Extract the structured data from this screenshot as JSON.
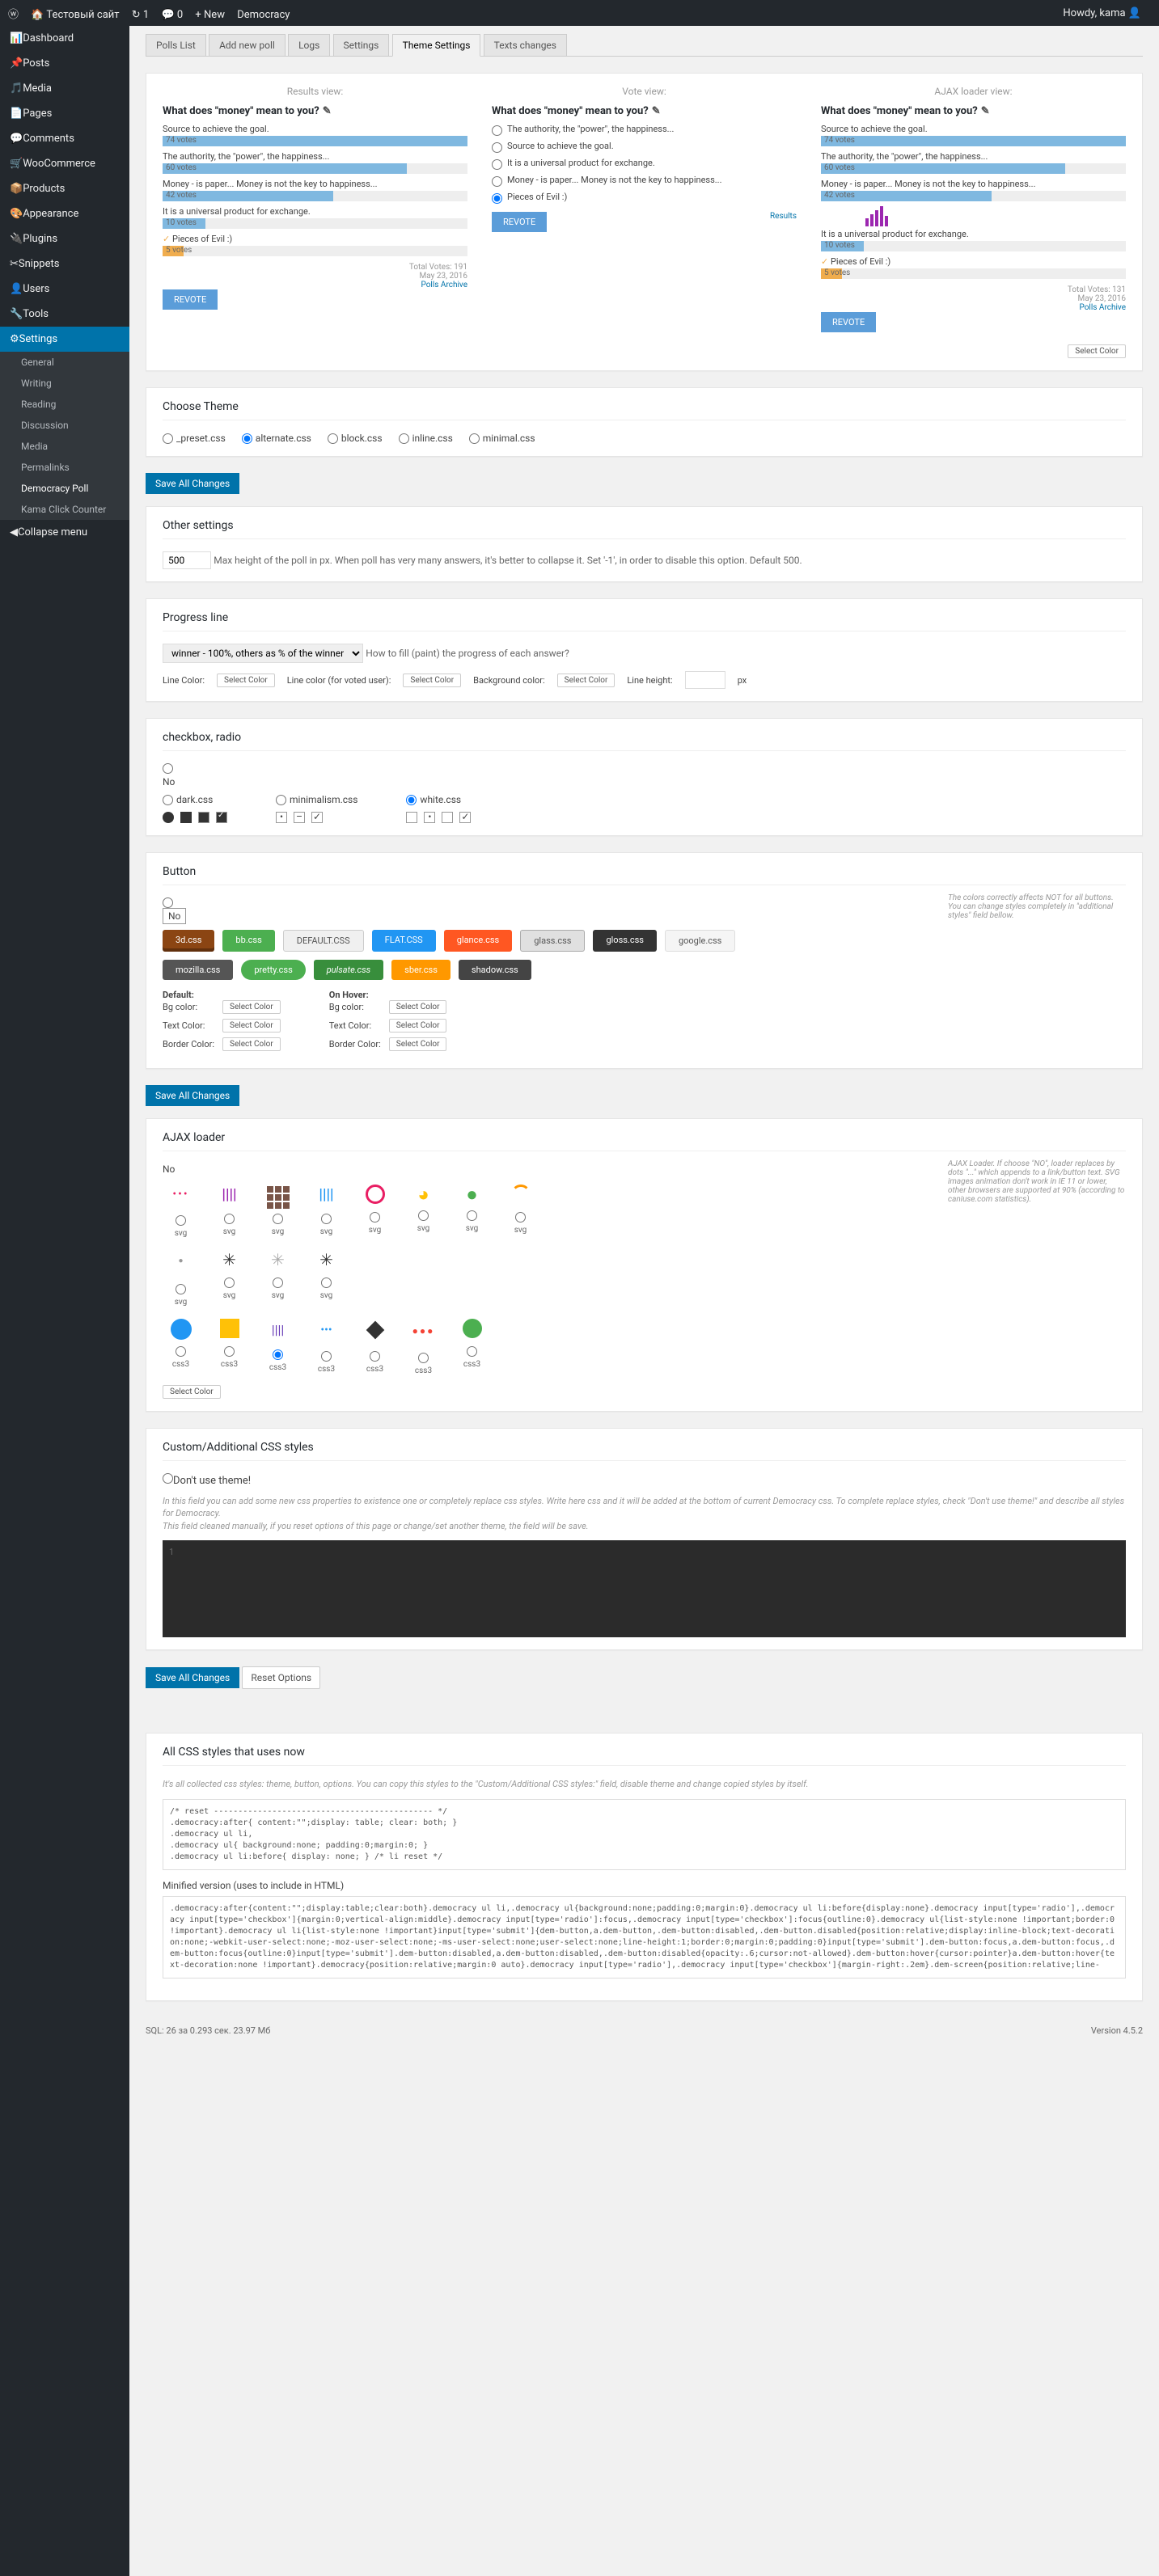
{
  "adminbar": {
    "site": "Тестовый сайт",
    "updates": "1",
    "comments": "0",
    "new": "+ New",
    "current_page": "Democracy",
    "howdy": "Howdy, kama"
  },
  "menu": {
    "items": [
      "Dashboard",
      "Posts",
      "Media",
      "Pages",
      "Comments",
      "WooCommerce",
      "Products",
      "Appearance",
      "Plugins",
      "Snippets",
      "Users",
      "Tools",
      "Settings"
    ],
    "sub": [
      "General",
      "Writing",
      "Reading",
      "Discussion",
      "Media",
      "Permalinks",
      "Democracy Poll",
      "Kama Click Counter"
    ],
    "collapse": "Collapse menu"
  },
  "tabs": [
    "Polls List",
    "Add new poll",
    "Logs",
    "Settings",
    "Theme Settings",
    "Texts changes"
  ],
  "poll": {
    "cols": [
      "Results view:",
      "Vote view:",
      "AJAX loader view:"
    ],
    "question": "What does \"money\" mean to you?",
    "answers": [
      {
        "text": "Source to achieve the goal.",
        "votes": "74 votes",
        "pct": 100
      },
      {
        "text": "The authority, the \"power\", the happiness...",
        "votes": "60 votes",
        "pct": 80
      },
      {
        "text": "Money - is paper... Money is not the key to happiness...",
        "votes": "42 votes",
        "pct": 56
      },
      {
        "text": "It is a universal product for exchange.",
        "votes": "10 votes",
        "pct": 14
      },
      {
        "text": "Pieces of Evil :)",
        "votes": "5 votes",
        "pct": 7,
        "winner": true
      }
    ],
    "vote_options": [
      "The authority, the \"power\", the happiness...",
      "Source to achieve the goal.",
      "It is a universal product for exchange.",
      "Money - is paper... Money is not the key to happiness...",
      "Pieces of Evil :)"
    ],
    "meta1": {
      "total": "Total Votes: 191",
      "date": "May 23, 2016",
      "archive": "Polls Archive"
    },
    "meta3": {
      "total": "Total Votes: 131",
      "date": "May 23, 2016",
      "archive": "Polls Archive"
    },
    "revote": "REVOTE",
    "results": "Results",
    "select_color": "Select Color"
  },
  "theme": {
    "title": "Choose Theme",
    "options": [
      "_preset.css",
      "alternate.css",
      "block.css",
      "inline.css",
      "minimal.css"
    ]
  },
  "save": "Save All Changes",
  "other": {
    "title": "Other settings",
    "value": "500",
    "desc": "Max height of the poll in px. When poll has very many answers, it's better to collapse it. Set '-1', in order to disable this option. Default 500."
  },
  "progress": {
    "title": "Progress line",
    "sel": "winner - 100%, others as % of the winner",
    "desc": "How to fill (paint) the progress of each answer?",
    "linecolor": "Line Color:",
    "linecolorvoted": "Line color (for voted user):",
    "bgcolor": "Background color:",
    "lineheight": "Line height:",
    "px": "px",
    "selcolor": "Select Color"
  },
  "checkbox": {
    "title": "checkbox, radio",
    "no": "No",
    "options": [
      "dark.css",
      "minimalism.css",
      "white.css"
    ]
  },
  "button": {
    "title": "Button",
    "no": "No",
    "note": "The colors correctly affects NOT for all buttons. You can change styles completely in \"additional styles\" field bellow.",
    "styles": [
      "3d.css",
      "bb.css",
      "DEFAULT.CSS",
      "FLAT.CSS",
      "glance.css",
      "glass.css",
      "gloss.css",
      "google.css",
      "mozilla.css",
      "pretty.css",
      "pulsate.css",
      "sber.css",
      "shadow.css"
    ],
    "default": "Default:",
    "hover": "On Hover:",
    "bg": "Bg color:",
    "text": "Text Color:",
    "border": "Border Color:",
    "selcolor": "Select Color"
  },
  "ajax": {
    "title": "AJAX loader",
    "no": "No",
    "note": "AJAX Loader. If choose \"NO\", loader replaces by dots \"...\" which appends to a link/button text. SVG images animation don't work in IE 11 or lower, other browsers are supported at 90% (according to caniuse.com statistics).",
    "svg": "svg",
    "css3": "css3",
    "selcolor": "Select Color"
  },
  "custom": {
    "title": "Custom/Additional CSS styles",
    "dont": "Don't use theme!",
    "h1": "In this field you can add some new css properties to existence one or completely replace css styles. Write here css and it will be added at the bottom of current Democracy css. To complete replace styles, check \"Don't use theme!\" and describe all styles for Democracy.",
    "h2": "This field cleaned manually, if you reset options of this page or change/set another theme, the field will be save.",
    "line": "1"
  },
  "reset": "Reset Options",
  "allcss": {
    "title": "All CSS styles that uses now",
    "desc": "It's all collected css styles: theme, button, options. You can copy this styles to the \"Custom/Additional CSS styles:\" field, disable theme and change copied styles by itself.",
    "css1": "/* reset --------------------------------------------- */\n.democracy:after{ content:\"\";display: table; clear: both; }\n.democracy ul li,\n.democracy ul{ background:none; padding:0;margin:0; }\n.democracy ul li:before{ display: none; } /* li reset */",
    "min": "Minified version (uses to include in HTML)",
    "css2": ".democracy:after{content:\"\";display:table;clear:both}.democracy ul li,.democracy ul{background:none;padding:0;margin:0}.democracy ul li:before{display:none}.democracy input[type='radio'],.democracy input[type='checkbox']{margin:0;vertical-align:middle}.democracy input[type='radio']:focus,.democracy input[type='checkbox']:focus{outline:0}.democracy ul{list-style:none !important;border:0 !important}.democracy ul li{list-style:none !important}input[type='submit']{dem-button,a.dem-button,.dem-button:disabled,.dem-button.disabled{position:relative;display:inline-block;text-decoration:none;-webkit-user-select:none;-moz-user-select:none;-ms-user-select:none;user-select:none;line-height:1;border:0;margin:0;padding:0}input[type='submit'].dem-button:focus,a.dem-button:focus,.dem-button:focus{outline:0}input[type='submit'].dem-button:disabled,a.dem-button:disabled,.dem-button:disabled{opacity:.6;cursor:not-allowed}.dem-button:hover{cursor:pointer}a.dem-button:hover{text-decoration:none !important}.democracy{position:relative;margin:0 auto}.democracy input[type='radio'],.democracy input[type='checkbox']{margin-right:.2em}.dem-screen{position:relative;line-"
  },
  "footer": {
    "sql": "SQL: 26 за 0.293 сек. 23.97 Мб",
    "version": "Version 4.5.2"
  }
}
